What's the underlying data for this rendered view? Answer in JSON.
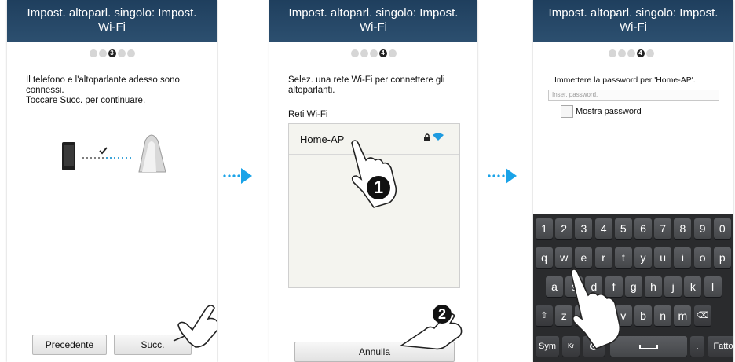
{
  "screens": {
    "s1": {
      "title": "Impost. altoparl. singolo: Impost.\nWi-Fi",
      "step": "3",
      "message": "Il telefono e l'altoparlante adesso sono\nconnessi.\nToccare Succ. per continuare.",
      "prev_label": "Precedente",
      "next_label": "Succ."
    },
    "s2": {
      "title": "Impost. altoparl. singolo: Impost.\nWi-Fi",
      "step": "4",
      "message": "Selez. una rete Wi-Fi per connettere gli\naltoparlanti.",
      "list_label": "Reti Wi-Fi",
      "network_name": "Home-AP",
      "callout_1": "1",
      "callout_2": "2",
      "cancel_label": "Annulla"
    },
    "s3": {
      "title": "Impost. altoparl. singolo: Impost.\nWi-Fi",
      "step": "4",
      "message": "Immettere la password per 'Home-AP'.",
      "password_placeholder": "Inser. password.",
      "show_password_label": "Mostra password"
    }
  },
  "keyboard": {
    "row1": [
      "1",
      "2",
      "3",
      "4",
      "5",
      "6",
      "7",
      "8",
      "9",
      "0"
    ],
    "row2": [
      "q",
      "w",
      "e",
      "r",
      "t",
      "y",
      "u",
      "i",
      "o",
      "p"
    ],
    "row3": [
      "a",
      "s",
      "d",
      "f",
      "g",
      "h",
      "j",
      "k",
      "l"
    ],
    "row4": [
      "⇧",
      "z",
      "x",
      "c",
      "v",
      "b",
      "n",
      "m",
      "⌫"
    ],
    "sym_label": "Sym",
    "lang_label": "Kr",
    "done_label": "Fatto"
  },
  "colors": {
    "accent": "#1aa3e8",
    "titlebar": "#2c4f6f",
    "wifi": "#1e9be0"
  }
}
